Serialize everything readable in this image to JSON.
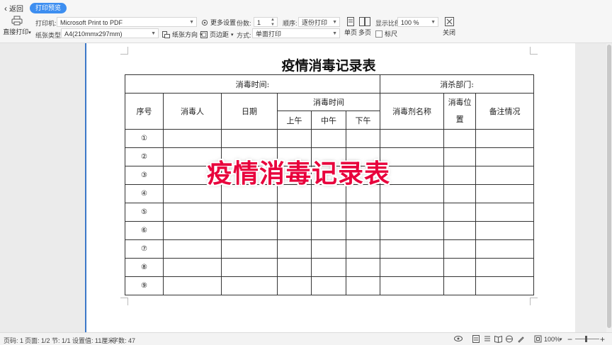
{
  "toolbar": {
    "back_label": "返回",
    "print_preview_tab": "打印预览",
    "direct_print_label": "直接打印",
    "printer_label": "打印机:",
    "printer_value": "Microsoft Print to PDF",
    "paper_type_label": "纸张类型:",
    "paper_type_value": "A4(210mmx297mm)",
    "more_settings_label": "更多设置",
    "paper_orientation_label": "纸张方向",
    "margins_label": "页边距",
    "copies_label": "份数:",
    "copies_value": "1",
    "mode_label": "方式:",
    "mode_value": "单面打印",
    "order_label": "顺序:",
    "order_value": "逐份打印",
    "zoom_label": "显示比例",
    "zoom_value": "100 %",
    "single_page_label": "单页",
    "multi_page_label": "多页",
    "ruler_label": "标尺",
    "close_label": "关闭"
  },
  "document": {
    "title": "疫情消毒记录表",
    "info_left": "消毒时间:",
    "info_right": "消杀部门:",
    "headers": {
      "seq": "序号",
      "person": "消毒人",
      "date": "日期",
      "time_group": "消毒时间",
      "morning": "上午",
      "noon": "中午",
      "afternoon": "下午",
      "agent": "消毒剂名称",
      "position_1": "消毒位",
      "position_2": "置",
      "notes": "备注情况"
    },
    "rows": [
      "①",
      "②",
      "③",
      "④",
      "⑤",
      "⑥",
      "⑦",
      "⑧",
      "⑨"
    ]
  },
  "overlay_caption": "疫情消毒记录表",
  "statusbar": {
    "page_no": "页码: 1",
    "pages": "页面: 1/2",
    "section": "节: 1/1",
    "setting": "设置值: 11厘米",
    "words": "字数: 47",
    "zoom": "100%"
  },
  "colors": {
    "accent": "#3d8ef0",
    "overlay_text": "#e8003c",
    "page_border": "#3c78c8"
  }
}
